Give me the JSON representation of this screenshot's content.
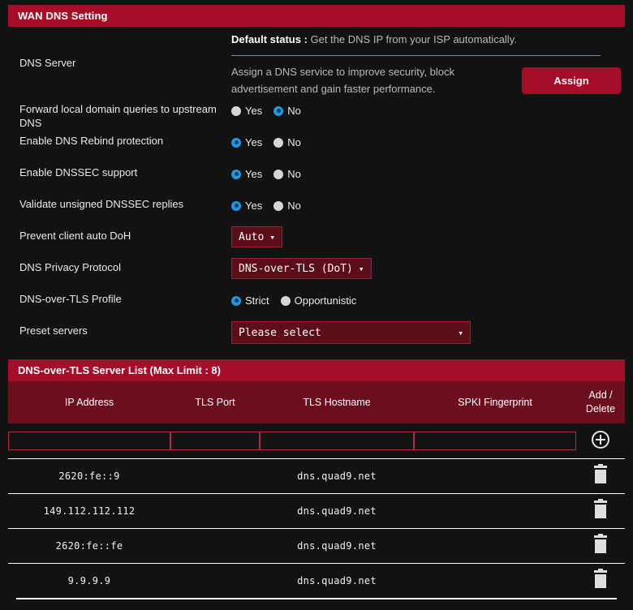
{
  "section": {
    "title": "WAN DNS Setting"
  },
  "dns_server": {
    "label": "DNS Server",
    "status_label": "Default status :",
    "status_value": " Get the DNS IP from your ISP automatically.",
    "description": "Assign a DNS service to improve security, block advertisement and gain faster performance.",
    "assign_label": "Assign"
  },
  "options": [
    {
      "label": "Forward local domain queries to upstream DNS",
      "name": "forward-local-domain-queries",
      "choices": [
        {
          "label": "Yes",
          "selected": false
        },
        {
          "label": "No",
          "selected": true
        }
      ]
    },
    {
      "label": "Enable DNS Rebind protection",
      "name": "enable-dns-rebind-protection",
      "choices": [
        {
          "label": "Yes",
          "selected": true
        },
        {
          "label": "No",
          "selected": false
        }
      ]
    },
    {
      "label": "Enable DNSSEC support",
      "name": "enable-dnssec-support",
      "choices": [
        {
          "label": "Yes",
          "selected": true
        },
        {
          "label": "No",
          "selected": false
        }
      ]
    },
    {
      "label": "Validate unsigned DNSSEC replies",
      "name": "validate-unsigned-dnssec-replies",
      "choices": [
        {
          "label": "Yes",
          "selected": true
        },
        {
          "label": "No",
          "selected": false
        }
      ]
    }
  ],
  "prevent_doh": {
    "label": "Prevent client auto DoH",
    "value": "Auto"
  },
  "privacy_protocol": {
    "label": "DNS Privacy Protocol",
    "value": "DNS-over-TLS (DoT)"
  },
  "tls_profile": {
    "label": "DNS-over-TLS Profile",
    "choices": [
      {
        "label": "Strict",
        "selected": true
      },
      {
        "label": "Opportunistic",
        "selected": false
      }
    ]
  },
  "preset_servers": {
    "label": "Preset servers",
    "value": "Please select"
  },
  "server_list": {
    "title": "DNS-over-TLS Server List (Max Limit : 8)",
    "columns": {
      "ip": "IP Address",
      "port": "TLS Port",
      "host": "TLS Hostname",
      "spki": "SPKI Fingerprint",
      "action_line1": "Add /",
      "action_line2": "Delete"
    },
    "new_row": {
      "ip": "",
      "port": "",
      "host": "",
      "spki": ""
    },
    "rows": [
      {
        "ip": "2620:fe::9",
        "port": "",
        "host": "dns.quad9.net",
        "spki": ""
      },
      {
        "ip": "149.112.112.112",
        "port": "",
        "host": "dns.quad9.net",
        "spki": ""
      },
      {
        "ip": "2620:fe::fe",
        "port": "",
        "host": "dns.quad9.net",
        "spki": ""
      },
      {
        "ip": "9.9.9.9",
        "port": "",
        "host": "dns.quad9.net",
        "spki": ""
      }
    ]
  },
  "icons": {
    "add": "plus-circle-icon",
    "delete": "trash-icon",
    "chevron": "chevron-down-icon"
  },
  "colors": {
    "accent": "#a50d28",
    "panel_header": "#6b0f1e",
    "select_bg": "#5c0d1a",
    "select_border": "#a11f30",
    "radio_on": "#2196e3",
    "background": "#121212"
  }
}
